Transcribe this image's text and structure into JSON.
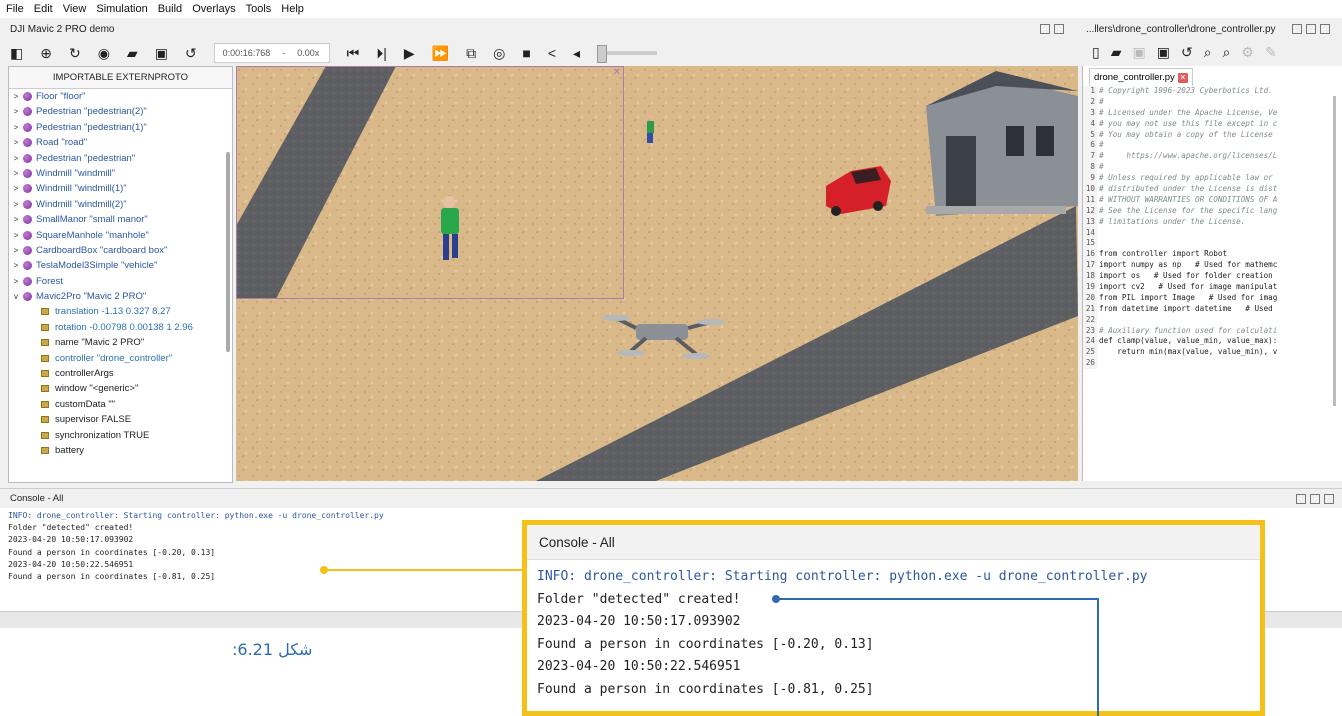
{
  "menu": [
    "File",
    "Edit",
    "View",
    "Simulation",
    "Build",
    "Overlays",
    "Tools",
    "Help"
  ],
  "window": {
    "title": "DJI Mavic 2 PRO demo",
    "editor_path": "...llers\\drone_controller\\drone_controller.py"
  },
  "toolbar": {
    "time": "0:00:16:768",
    "speed_sep": "-",
    "speed": "0.00x"
  },
  "scene_tree": {
    "header": "IMPORTABLE EXTERNPROTO",
    "nodes": [
      {
        "label": "Floor \"floor\"",
        "arrow": ">"
      },
      {
        "label": "Pedestrian \"pedestrian(2)\"",
        "arrow": ">"
      },
      {
        "label": "Pedestrian \"pedestrian(1)\"",
        "arrow": ">"
      },
      {
        "label": "Road \"road\"",
        "arrow": ">"
      },
      {
        "label": "Pedestrian \"pedestrian\"",
        "arrow": ">"
      },
      {
        "label": "Windmill \"windmill\"",
        "arrow": ">"
      },
      {
        "label": "Windmill \"windmill(1)\"",
        "arrow": ">"
      },
      {
        "label": "Windmill \"windmill(2)\"",
        "arrow": ">"
      },
      {
        "label": "SmallManor \"small manor\"",
        "arrow": ">"
      },
      {
        "label": "SquareManhole \"manhole\"",
        "arrow": ">"
      },
      {
        "label": "CardboardBox \"cardboard box\"",
        "arrow": ">"
      },
      {
        "label": "TeslaModel3Simple \"vehicle\"",
        "arrow": ">"
      },
      {
        "label": "Forest",
        "arrow": ">"
      },
      {
        "label": "Mavic2Pro \"Mavic 2 PRO\"",
        "arrow": "v"
      }
    ],
    "fields": [
      {
        "label": "translation -1.13 0.327 8.27",
        "color": "blue"
      },
      {
        "label": "rotation -0.00798 0.00138 1 2.96",
        "color": "blue"
      },
      {
        "label": "name \"Mavic 2 PRO\"",
        "color": "black"
      },
      {
        "label": "controller \"drone_controller\"",
        "color": "blue"
      },
      {
        "label": "controllerArgs",
        "color": "black"
      },
      {
        "label": "window \"<generic>\"",
        "color": "black"
      },
      {
        "label": "customData \"\"",
        "color": "black"
      },
      {
        "label": "supervisor FALSE",
        "color": "black"
      },
      {
        "label": "synchronization TRUE",
        "color": "black"
      },
      {
        "label": "battery",
        "color": "black"
      }
    ]
  },
  "editor": {
    "tab_label": "drone_controller.py",
    "lines": [
      {
        "n": "1",
        "text": "# Copyright 1996-2023 Cyberbotics Ltd.",
        "kind": "comment"
      },
      {
        "n": "2",
        "text": "#",
        "kind": "comment"
      },
      {
        "n": "3",
        "text": "# Licensed under the Apache License, Ve",
        "kind": "comment"
      },
      {
        "n": "4",
        "text": "# you may not use this file except in c",
        "kind": "comment"
      },
      {
        "n": "5",
        "text": "# You may obtain a copy of the License",
        "kind": "comment"
      },
      {
        "n": "6",
        "text": "#",
        "kind": "comment"
      },
      {
        "n": "7",
        "text": "#     https://www.apache.org/licenses/L",
        "kind": "comment"
      },
      {
        "n": "8",
        "text": "#",
        "kind": "comment"
      },
      {
        "n": "9",
        "text": "# Unless required by applicable law or",
        "kind": "comment"
      },
      {
        "n": "10",
        "text": "# distributed under the License is dist",
        "kind": "comment"
      },
      {
        "n": "11",
        "text": "# WITHOUT WARRANTIES OR CONDITIONS OF A",
        "kind": "comment"
      },
      {
        "n": "12",
        "text": "# See the License for the specific lang",
        "kind": "comment"
      },
      {
        "n": "13",
        "text": "# limitations under the License.",
        "kind": "comment"
      },
      {
        "n": "14",
        "text": "",
        "kind": "code"
      },
      {
        "n": "15",
        "text": "",
        "kind": "code"
      },
      {
        "n": "16",
        "text": "from controller import Robot",
        "kind": "code"
      },
      {
        "n": "17",
        "text": "import numpy as np   # Used for mathemc",
        "kind": "code"
      },
      {
        "n": "18",
        "text": "import os   # Used for folder creation",
        "kind": "code"
      },
      {
        "n": "19",
        "text": "import cv2   # Used for image manipulat",
        "kind": "code"
      },
      {
        "n": "20",
        "text": "from PIL import Image   # Used for imag",
        "kind": "code"
      },
      {
        "n": "21",
        "text": "from datetime import datetime   # Used",
        "kind": "code"
      },
      {
        "n": "22",
        "text": "",
        "kind": "code"
      },
      {
        "n": "23",
        "text": "# Auxiliary function used for calculati",
        "kind": "comment"
      },
      {
        "n": "24",
        "text": "def clamp(value, value_min, value_max):",
        "kind": "code"
      },
      {
        "n": "25",
        "text": "    return min(max(value, value_min), v",
        "kind": "code"
      },
      {
        "n": "26",
        "text": "",
        "kind": "code"
      }
    ]
  },
  "console": {
    "title": "Console - All",
    "lines": [
      {
        "text": "INFO: drone_controller: Starting controller: python.exe -u drone_controller.py",
        "kind": "info"
      },
      {
        "text": "Folder \"detected\" created!",
        "kind": "plain"
      },
      {
        "text": "2023-04-20 10:50:17.093902",
        "kind": "plain"
      },
      {
        "text": "Found a person in coordinates [-0.20, 0.13]",
        "kind": "plain"
      },
      {
        "text": "2023-04-20 10:50:22.546951",
        "kind": "plain"
      },
      {
        "text": "Found a person in coordinates [-0.81, 0.25]",
        "kind": "plain"
      }
    ]
  },
  "figure_label": "شكل 6.21:",
  "colors": {
    "highlight_border": "#f5c118",
    "callout_blue": "#2f6bb0",
    "info_text": "#2b57a1"
  }
}
